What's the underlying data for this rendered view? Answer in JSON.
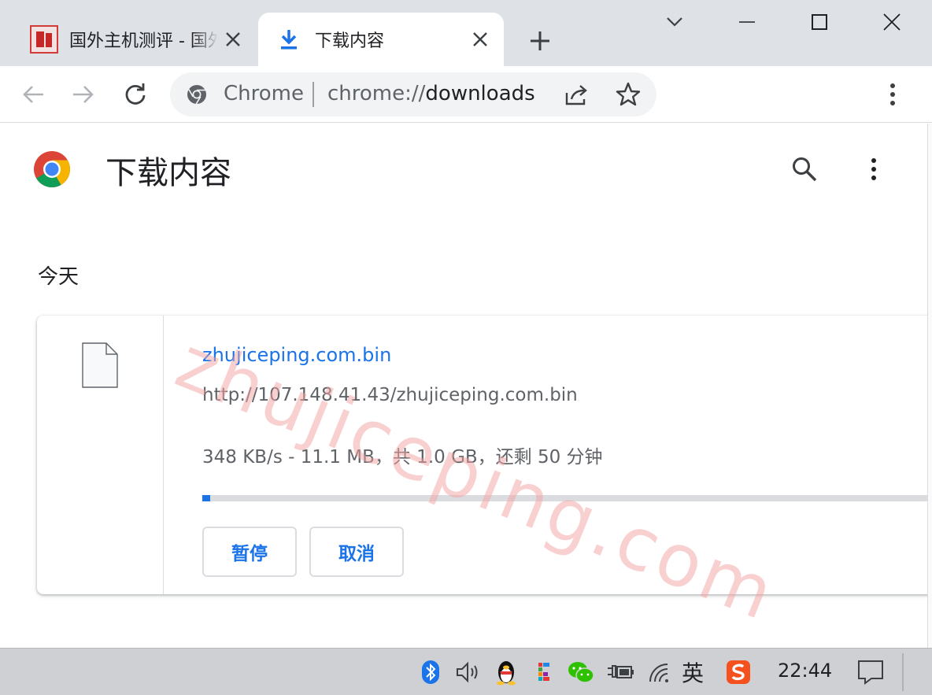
{
  "tabs": [
    {
      "title": "国外主机测评 - 国外VPS、国外服务器",
      "active": false
    },
    {
      "title": "下载内容",
      "active": true
    }
  ],
  "toolbar": {
    "site_label": "Chrome",
    "url_scheme": "chrome://",
    "url_rest": "downloads"
  },
  "page": {
    "title": "下载内容",
    "date_heading": "今天"
  },
  "download": {
    "file_name": "zhujiceping.com.bin",
    "source_url": "http://107.148.41.43/zhujiceping.com.bin",
    "status": "348 KB/s - 11.1 MB，共 1.0 GB，还剩 50 分钟",
    "progress_percent": 1.1,
    "pause_label": "暂停",
    "cancel_label": "取消"
  },
  "watermark": "zhujiceping.com",
  "taskbar": {
    "ime_label": "英",
    "clock": "22:44"
  },
  "colors": {
    "accent": "#1a73e8",
    "tabstrip": "#dee1e6",
    "taskbar": "#cfd0d4"
  }
}
